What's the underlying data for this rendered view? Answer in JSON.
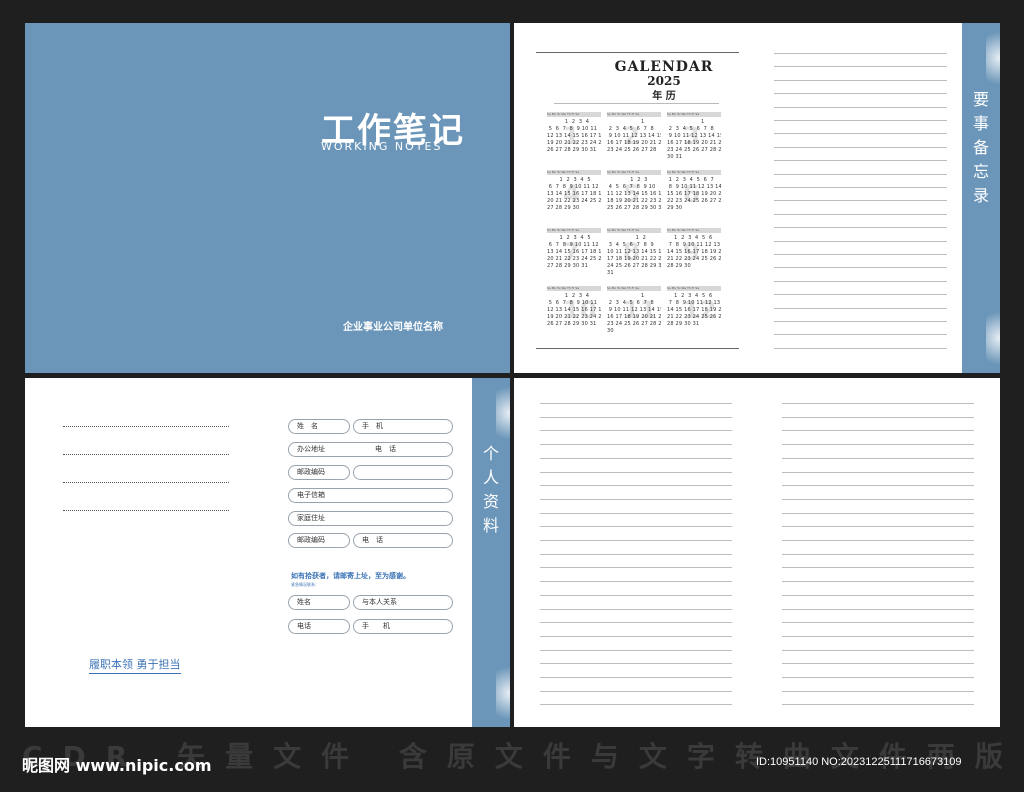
{
  "cover": {
    "title": "工作笔记",
    "subtitle": "WORKING NOTES",
    "company": "企业事业公司单位名称"
  },
  "calendar": {
    "title": "GALENDAR",
    "year": "2025",
    "subtitle": "年 历",
    "weekday_header": "Su Mo Tu We Th Fr Sa",
    "months": [
      "1",
      "2",
      "3",
      "4",
      "5",
      "6",
      "7",
      "8",
      "9",
      "10",
      "11",
      "12"
    ]
  },
  "memo_tab": [
    "要",
    "事",
    "备",
    "忘",
    "录"
  ],
  "personal_tab": [
    "个",
    "人",
    "资",
    "料"
  ],
  "form": {
    "name": "姓　名",
    "mobile": "手　机",
    "office_address": "办公地址",
    "office_phone": "电　话",
    "postcode": "邮政编码",
    "email": "电子信箱",
    "home_address": "家庭住址",
    "home_postcode": "邮政编码",
    "home_phone": "电　话",
    "lost_notice": "如有拾获者，请邮寄上址，至为感谢。",
    "emergency_contact": "紧急情况联系：",
    "contact_name": "姓名",
    "relation": "与本人关系",
    "contact_phone": "电话",
    "contact_mobile": "手　　机"
  },
  "motto": "履职本领 勇于担当",
  "watermark": "CDR 矢量文件   含原文件与文字转曲文件两版",
  "site": "昵图网 www.nipic.com",
  "image_id": "ID:10951140 NO:20231225111716673109",
  "colors": {
    "accent": "#6b96b9",
    "link": "#3b73b5"
  }
}
